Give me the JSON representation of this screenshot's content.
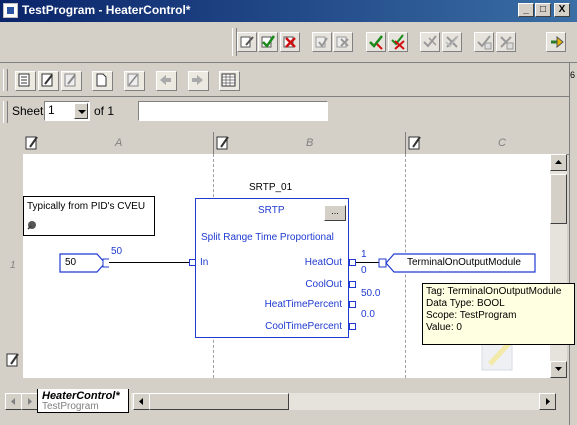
{
  "window": {
    "title": "TestProgram - HeaterControl*",
    "minimize": "_",
    "maximize": "□",
    "close": "X"
  },
  "toolbar1": {
    "icons": [
      "edit-rungs-icon",
      "verify-icon",
      "cancel-edits-icon",
      "accept-pending-icon",
      "test-edits-icon",
      "assemble-icon",
      "cancel-pending-icon",
      "accept-program-icon",
      "test-program-icon",
      "untest-icon",
      "finalize-icon",
      "cycle-icon"
    ]
  },
  "toolbar2": {
    "icons": [
      "properties-icon",
      "edit-properties-icon",
      "add-sheet-icon",
      "new-sheet-icon",
      "delete-sheet-icon",
      "previous-sheet-icon",
      "next-sheet-icon",
      "sheet-layout-icon"
    ]
  },
  "sheet": {
    "label": "Sheet",
    "value": "1",
    "of_label": "of 1",
    "description": ""
  },
  "columns": [
    "A",
    "B",
    "C"
  ],
  "rows": [
    "1"
  ],
  "comment": {
    "text": "Typically from PID's CVEU"
  },
  "input_ref": {
    "value": "50",
    "wire_value": "50",
    "pin": "In"
  },
  "block": {
    "tag": "SRTP_01",
    "type": "SRTP",
    "description": "Split Range Time Proportional",
    "button": "...",
    "pins": [
      {
        "name": "HeatOut",
        "value_top": "1",
        "value_bottom": "0"
      },
      {
        "name": "CoolOut",
        "value": "50.0"
      },
      {
        "name": "HeatTimePercent",
        "value": "0.0"
      },
      {
        "name": "CoolTimePercent",
        "value": ""
      }
    ]
  },
  "output_ref": {
    "tag": "TerminalOnOutputModule"
  },
  "tooltip": {
    "tag": "Tag: TerminalOnOutputModule",
    "datatype": "Data Type: BOOL",
    "scope": "Scope: TestProgram",
    "value": "Value: 0"
  },
  "tab": {
    "label": "HeaterControl*",
    "sublabel": "TestProgram"
  },
  "colors": {
    "titlebar": "#0a246a",
    "block_blue": "#1f3ad0",
    "tooltip_bg": "#ffffe1"
  }
}
